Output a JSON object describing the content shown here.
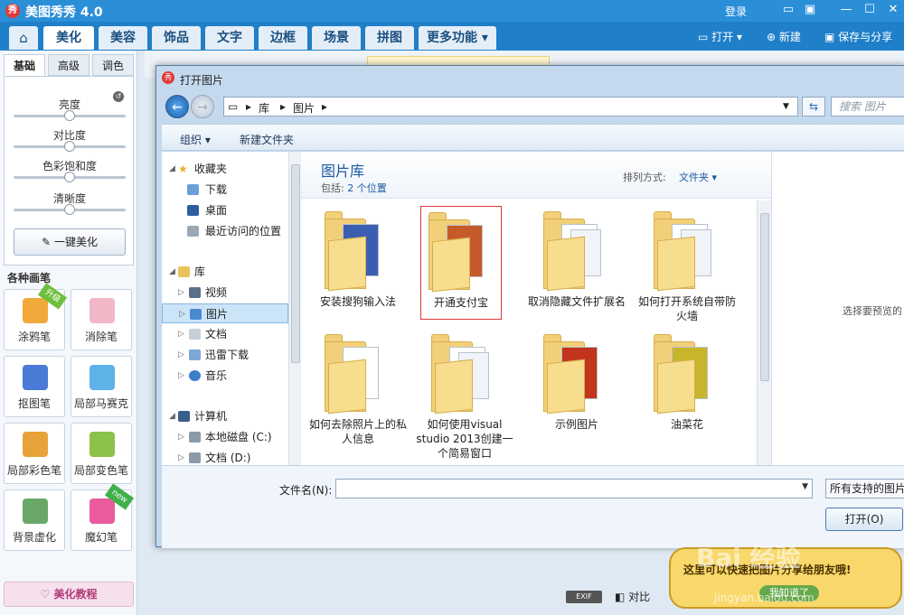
{
  "app": {
    "title": "美图秀秀 4.0",
    "logo_text": "秀",
    "login": "登录",
    "window_icons": [
      "chat-icon",
      "skin-icon",
      "minimize-icon",
      "maximize-icon",
      "close-icon"
    ]
  },
  "tabs": [
    "美化",
    "美容",
    "饰品",
    "文字",
    "边框",
    "场景",
    "拼图",
    "更多功能"
  ],
  "active_tab": "美化",
  "toolbar_actions": {
    "open": "打开",
    "new": "新建",
    "save_share": "保存与分享"
  },
  "left_panel": {
    "subtabs": [
      "基础",
      "高级",
      "调色"
    ],
    "sliders": [
      {
        "label": "亮度",
        "value": 0.5
      },
      {
        "label": "对比度",
        "value": 0.5
      },
      {
        "label": "色彩饱和度",
        "value": 0.5
      },
      {
        "label": "清晰度",
        "value": 0.5
      }
    ],
    "one_click": "一键美化",
    "section_title": "各种画笔",
    "tools": [
      {
        "label": "涂鸦笔",
        "badge": "升级",
        "color": "#f0a93a"
      },
      {
        "label": "消除笔",
        "badge": "",
        "color": "#f2b7c6"
      },
      {
        "label": "抠图笔",
        "badge": "",
        "color": "#4b7bd6"
      },
      {
        "label": "局部马赛克",
        "badge": "",
        "color": "#5fb2e8"
      },
      {
        "label": "局部彩色笔",
        "badge": "",
        "color": "#e8a23a"
      },
      {
        "label": "局部变色笔",
        "badge": "",
        "color": "#8bc24a"
      },
      {
        "label": "背景虚化",
        "badge": "",
        "color": "#6aa86a"
      },
      {
        "label": "魔幻笔",
        "badge": "new",
        "color": "#e95b9a"
      }
    ],
    "tutorial": "美化教程"
  },
  "bottom_bar": {
    "exif": "EXIF",
    "compare": "对比"
  },
  "bubble": {
    "text": "这里可以快速把图片分享给朋友哦!",
    "button": "我知道了"
  },
  "watermark": {
    "logo": "Bai 经验",
    "url": "jingyan.baidu.com"
  },
  "dialog": {
    "title": "打开图片",
    "path": [
      "库",
      "图片"
    ],
    "search_placeholder": "搜索 图片",
    "commands": {
      "organize": "组织",
      "new_folder": "新建文件夹"
    },
    "nav": {
      "favorites": "收藏夹",
      "favorites_items": [
        "下载",
        "桌面",
        "最近访问的位置"
      ],
      "libraries": "库",
      "library_items": [
        "视频",
        "图片",
        "文档",
        "迅雷下载",
        "音乐"
      ],
      "selected": "图片",
      "computer": "计算机",
      "computer_items": [
        "本地磁盘 (C:)",
        "文档 (D:)"
      ]
    },
    "library": {
      "title": "图片库",
      "includes_label": "包括:",
      "includes_link": "2 个位置",
      "sort_label": "排列方式:",
      "sort_value": "文件夹"
    },
    "files": [
      {
        "name": "安装搜狗输入法",
        "selected": false
      },
      {
        "name": "开通支付宝",
        "selected": true
      },
      {
        "name": "取消隐藏文件扩展名",
        "selected": false
      },
      {
        "name": "如何打开系统自带防火墙",
        "selected": false
      },
      {
        "name": "如何去除照片上的私人信息",
        "selected": false
      },
      {
        "name": "如何使用visual studio 2013创建一个简易窗口",
        "selected": false
      },
      {
        "name": "示例图片",
        "selected": false
      },
      {
        "name": "油菜花",
        "selected": false
      }
    ],
    "preview_text": "选择要预览的",
    "filename_label": "文件名(N):",
    "filename_value": "",
    "type_value": "所有支持的图片格",
    "open_button": "打开(O)"
  }
}
